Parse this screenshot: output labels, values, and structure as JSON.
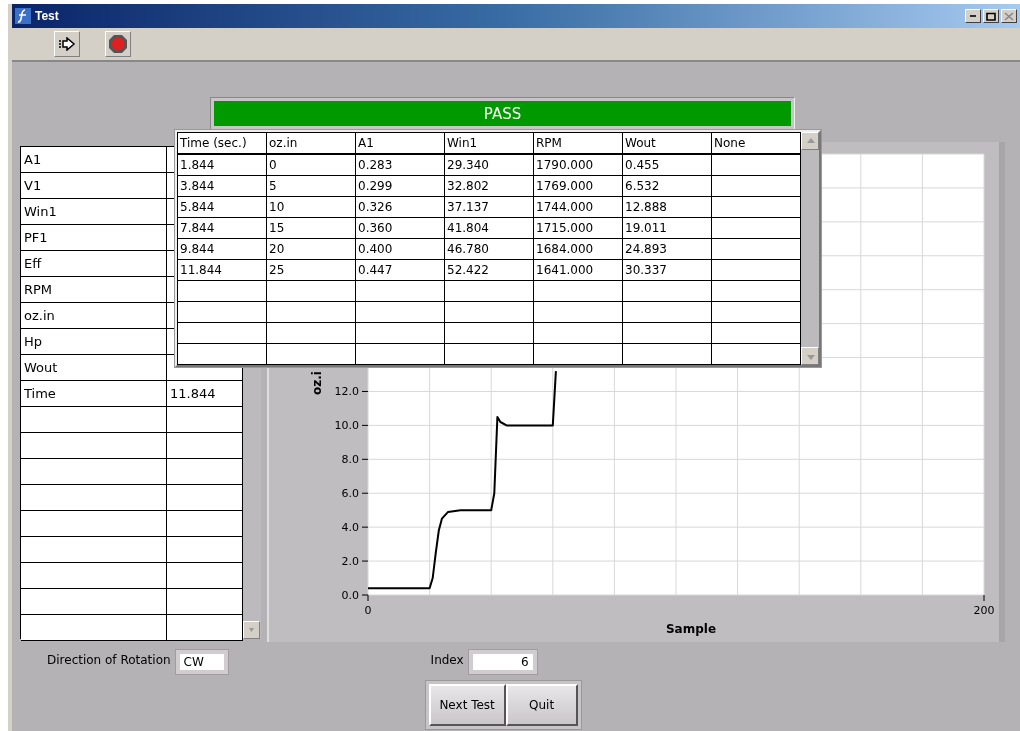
{
  "window": {
    "title": "Test"
  },
  "status": {
    "label": "PASS",
    "passed": true
  },
  "measurements": [
    {
      "label": "A1"
    },
    {
      "label": "V1"
    },
    {
      "label": "Win1"
    },
    {
      "label": "PF1"
    },
    {
      "label": "Eff"
    },
    {
      "label": "RPM"
    },
    {
      "label": "oz.in"
    },
    {
      "label": "Hp"
    },
    {
      "label": "Wout"
    },
    {
      "label": "Time",
      "value": "11.844"
    }
  ],
  "results_table": {
    "columns": [
      "Time (sec.)",
      "oz.in",
      "A1",
      "Win1",
      "RPM",
      "Wout",
      "None"
    ],
    "rows": [
      [
        "1.844",
        "0",
        "0.283",
        "29.340",
        "1790.000",
        "0.455"
      ],
      [
        "3.844",
        "5",
        "0.299",
        "32.802",
        "1769.000",
        "6.532"
      ],
      [
        "5.844",
        "10",
        "0.326",
        "37.137",
        "1744.000",
        "12.888"
      ],
      [
        "7.844",
        "15",
        "0.360",
        "41.804",
        "1715.000",
        "19.011"
      ],
      [
        "9.844",
        "20",
        "0.400",
        "46.780",
        "1684.000",
        "24.893"
      ],
      [
        "11.844",
        "25",
        "0.447",
        "52.422",
        "1641.000",
        "30.337"
      ]
    ]
  },
  "graph": {
    "chart_data": {
      "type": "line",
      "grid": true,
      "xlabel": "Sample",
      "ylabel": "oz.i",
      "xlim": [
        0,
        200
      ],
      "ylim": [
        0,
        26
      ],
      "xticks": [
        0,
        200
      ],
      "yticks": [
        {
          "value": 0,
          "label": "0.0"
        },
        {
          "value": 2,
          "label": "2.0"
        },
        {
          "value": 4,
          "label": "4.0"
        },
        {
          "value": 6,
          "label": "6.0"
        },
        {
          "value": 8,
          "label": "8.0"
        },
        {
          "value": 10,
          "label": "10.0"
        },
        {
          "value": 12,
          "label": "12.0"
        }
      ],
      "x": [
        0,
        20,
        21,
        22,
        23,
        24,
        26,
        30,
        40,
        41,
        42,
        43,
        45,
        60,
        61
      ],
      "series": [
        {
          "color": "#000000",
          "values": [
            0.4,
            0.4,
            1,
            2.5,
            3.8,
            4.5,
            4.9,
            5,
            5,
            6,
            10.5,
            10.2,
            10,
            10,
            13.2
          ]
        }
      ]
    }
  },
  "direction": {
    "label": "Direction of Rotation",
    "value": "CW"
  },
  "index": {
    "label": "Index",
    "value": "6"
  },
  "buttons": [
    "Next Test",
    "Quit"
  ]
}
